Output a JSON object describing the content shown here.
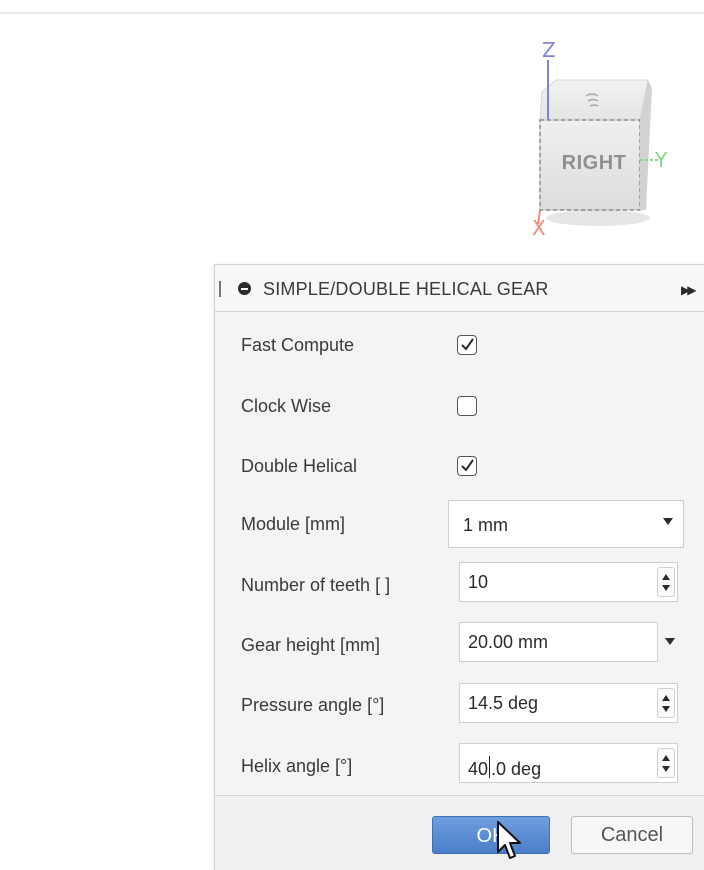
{
  "viewcube": {
    "face_label": "RIGHT",
    "axis_z": "Z",
    "axis_y": "Y",
    "axis_x": "X"
  },
  "dialog": {
    "title": "SIMPLE/DOUBLE HELICAL GEAR",
    "fast_compute": {
      "label": "Fast Compute",
      "checked": true
    },
    "clock_wise": {
      "label": "Clock Wise",
      "checked": false
    },
    "double_helical": {
      "label": "Double Helical",
      "checked": true
    },
    "module": {
      "label": "Module [mm]",
      "value": "1 mm"
    },
    "number_of_teeth": {
      "label": "Number of teeth [ ]",
      "value": "10"
    },
    "gear_height": {
      "label": "Gear height [mm]",
      "value": "20.00 mm"
    },
    "pressure_angle": {
      "label": "Pressure angle [°]",
      "value": "14.5 deg"
    },
    "helix_angle": {
      "label": "Helix angle [°]",
      "value_before_caret": "40",
      "value_after_caret": ".0 deg"
    },
    "ok_label": "OK",
    "cancel_label": "Cancel"
  },
  "colors": {
    "ok_button": "#5b8fd6",
    "axis_z": "#7b84d6",
    "axis_y": "#86d48a",
    "axis_x": "#f08a7a"
  },
  "icons": [
    "collapse-icon",
    "expand-icon",
    "check-icon",
    "spin-up-icon",
    "spin-down-icon",
    "dropdown-arrow-icon",
    "mouse-cursor-icon"
  ]
}
